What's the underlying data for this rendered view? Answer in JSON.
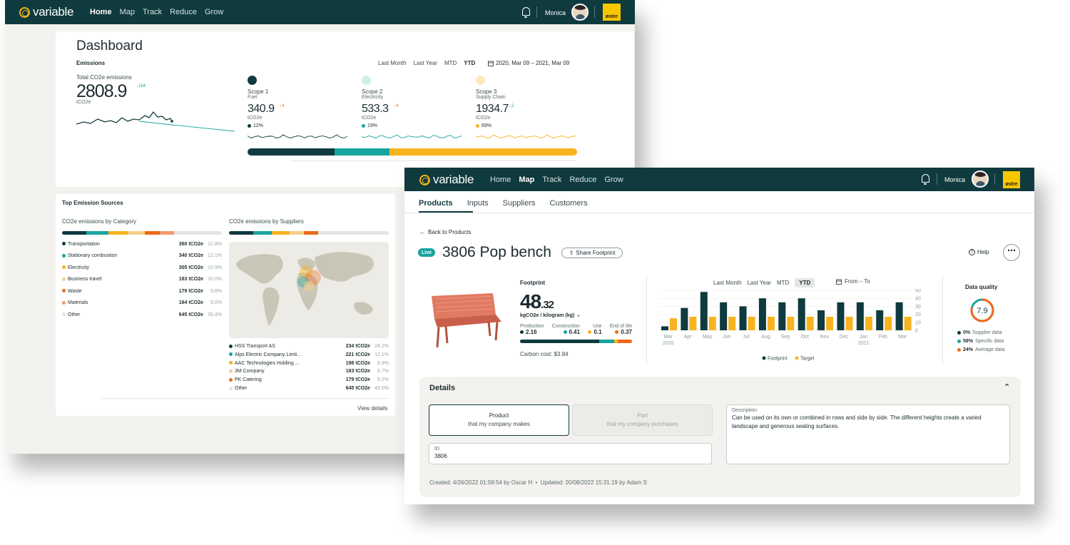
{
  "colors": {
    "teal_dark": "#0f3a3e",
    "teal": "#18a49e",
    "yellow": "#f7b320",
    "light_yellow": "#f5d08a",
    "orange": "#ee6a1c",
    "salmon": "#f39b6d",
    "grey": "#d9dcd8"
  },
  "dashboard": {
    "logo": "variable",
    "nav": [
      "Home",
      "Map",
      "Track",
      "Reduce",
      "Grow"
    ],
    "active_nav": "Home",
    "user": "Monica",
    "brand": "østre",
    "title": "Dashboard",
    "section": "Emissions",
    "periods": [
      "Last Month",
      "Last Year",
      "MTD",
      "YTD"
    ],
    "active_period": "YTD",
    "date_range": "2020, Mar 09 – 2021, Mar 09",
    "total_label": "Total CO2e emissions",
    "total_value": "2808.9",
    "total_delta": "↓154",
    "total_unit": "tCO2e",
    "scopes": [
      {
        "title": "Scope 1",
        "subtitle": "Fuel",
        "value": "340.9",
        "delta": "↑4",
        "unit": "tCO2e",
        "share": "12%",
        "color": "#0f3a3e",
        "icon": "drop-icon"
      },
      {
        "title": "Scope 2",
        "subtitle": "Electricity",
        "value": "533.3",
        "delta": "↑4",
        "unit": "tCO2e",
        "share": "19%",
        "color": "#18a49e",
        "icon": "bolt-icon"
      },
      {
        "title": "Scope 3",
        "subtitle": "Supply Chain",
        "value": "1934.7",
        "delta": "↓2",
        "unit": "tCO2e",
        "share": "69%",
        "color": "#f7b320",
        "icon": "chain-icon"
      }
    ],
    "sources_title": "Top Emission Sources",
    "by_category_title": "CO2e emissions by Category",
    "by_supplier_title": "CO2e emissions by Suppliers",
    "categories": [
      {
        "name": "Transportation",
        "value": "360 tCO2e",
        "pct": "12.8%",
        "color": "#0f3a3e"
      },
      {
        "name": "Stationary combustion",
        "value": "340 tCO2e",
        "pct": "12.1%",
        "color": "#18a49e"
      },
      {
        "name": "Electricity",
        "value": "305 tCO2e",
        "pct": "10.9%",
        "color": "#f7b320"
      },
      {
        "name": "Business travel",
        "value": "183 tCO2e",
        "pct": "10.0%",
        "color": "#f5d08a"
      },
      {
        "name": "Waste",
        "value": "179 tCO2e",
        "pct": "9.8%",
        "color": "#ee6a1c"
      },
      {
        "name": "Materials",
        "value": "164 tCO2e",
        "pct": "9.0%",
        "color": "#f39b6d"
      },
      {
        "name": "Other",
        "value": "645 tCO2e",
        "pct": "35.4%",
        "color": "#e3e5e2"
      }
    ],
    "suppliers": [
      {
        "name": "HSS Transport AS",
        "value": "234 tCO2e",
        "pct": "24.2%",
        "color": "#0f3a3e"
      },
      {
        "name": "Alps Electric Company Limit...",
        "value": "221 tCO2e",
        "pct": "12.1%",
        "color": "#18a49e"
      },
      {
        "name": "AAC Technologies Holding ...",
        "value": "198 tCO2e",
        "pct": "8.8%",
        "color": "#f7b320"
      },
      {
        "name": "3M Company",
        "value": "183 tCO2e",
        "pct": "6.7%",
        "color": "#f5d08a"
      },
      {
        "name": "PK Catering",
        "value": "179 tCO2e",
        "pct": "5.2%",
        "color": "#ee6a1c"
      },
      {
        "name": "Other",
        "value": "645 tCO2e",
        "pct": "43.0%",
        "color": "#e3e5e2"
      }
    ],
    "view_details": "View details"
  },
  "product": {
    "logo": "variable",
    "nav": [
      "Home",
      "Map",
      "Track",
      "Reduce",
      "Grow"
    ],
    "active_nav": "Map",
    "user": "Monica",
    "brand": "østre",
    "tabs": [
      "Products",
      "Inputs",
      "Suppliers",
      "Customers"
    ],
    "active_tab": "Products",
    "back": "Back to Products",
    "status": "Live",
    "title": "3806 Pop bench",
    "share": "Share Footprint",
    "help": "Help",
    "footprint_label": "Footprint",
    "footprint_int": "48",
    "footprint_dec": ".32",
    "footprint_unit": "kgCO2e / kilogram (kg)",
    "phases": [
      {
        "label": "Production",
        "value": "2.16",
        "color": "#0f3a3e"
      },
      {
        "label": "Construction",
        "value": "0.41",
        "color": "#18a49e"
      },
      {
        "label": "Use",
        "value": "0.1",
        "color": "#f7b320"
      },
      {
        "label": "End of life",
        "value": "0.37",
        "color": "#ee6a1c"
      }
    ],
    "carbon_cost": "Carbon cost: $3.84",
    "periods": [
      "Last Month",
      "Last Year",
      "MTD",
      "YTD"
    ],
    "active_period": "YTD",
    "range": "From – To",
    "data_quality_label": "Data quality",
    "data_quality_score": "7.9",
    "data_quality_fraction": 0.79,
    "quality_rows": [
      {
        "pct": "0%",
        "label": "Supplier data",
        "color": "#0f3a3e"
      },
      {
        "pct": "58%",
        "label": "Specific data",
        "color": "#18a49e"
      },
      {
        "pct": "24%",
        "label": "Average data",
        "color": "#ee6a1c"
      }
    ],
    "details_title": "Details",
    "product_option": {
      "title": "Product",
      "sub": "that my company makes"
    },
    "part_option": {
      "title": "Part",
      "sub": "that my company purchases"
    },
    "id_label": "ID",
    "id_value": "3806",
    "description_label": "Description",
    "description": "Can be used on its own or combined in rows and side by side. The different heights create a varied landscape and generous seating surfaces.",
    "meta": "Created: 4/26/2022 01:59:54 by Oscar H  •  Updated: 20/08/2022 15:31:19 by Adam S"
  },
  "chart_data": {
    "type": "bar",
    "categories": [
      "Mar",
      "Apr",
      "May",
      "Jun",
      "Jul",
      "Aug",
      "Sep",
      "Oct",
      "Nov",
      "Dec",
      "Jan",
      "Feb",
      "Mar"
    ],
    "year_labels": [
      "2020",
      "2021"
    ],
    "series": [
      {
        "name": "Footprint",
        "color": "#0f3a3e",
        "values": [
          5,
          28,
          48,
          35,
          30,
          40,
          35,
          40,
          25,
          35,
          35,
          25,
          35
        ]
      },
      {
        "name": "Target",
        "color": "#f7b320",
        "values": [
          15,
          17,
          17,
          17,
          17,
          17,
          17,
          17,
          17,
          17,
          17,
          17,
          17
        ]
      }
    ],
    "y_ticks": [
      50,
      40,
      30,
      20,
      10,
      0
    ],
    "ylim": [
      0,
      50
    ],
    "legend": "bottom"
  }
}
